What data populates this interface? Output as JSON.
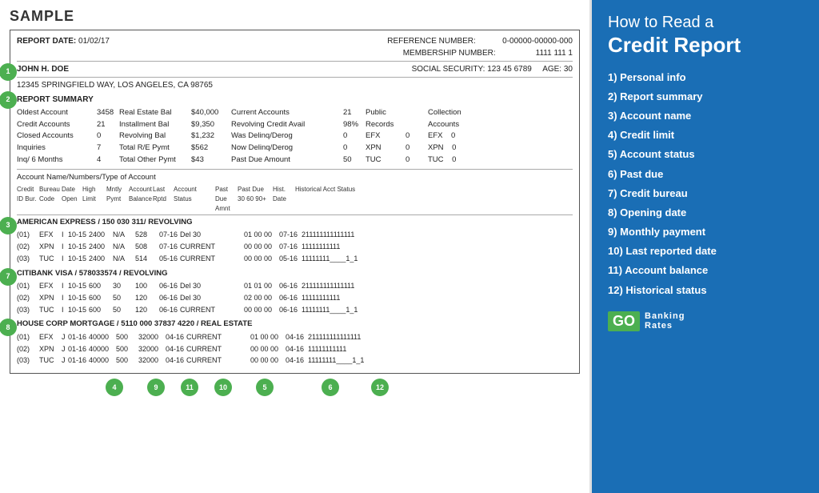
{
  "sample_label": "SAMPLE",
  "report_header": {
    "report_date_label": "REPORT DATE:",
    "report_date": "01/02/17",
    "reference_label": "REFERENCE NUMBER:",
    "reference_value": "0-00000-00000-000",
    "membership_label": "MEMBERSHIP NUMBER:",
    "membership_value": "1111 111 1"
  },
  "personal_info": {
    "name": "JOHN H. DOE",
    "social_label": "SOCIAL SECURITY:",
    "social_value": "123 45 6789",
    "age_label": "AGE:",
    "age_value": "30",
    "address": "12345 SPRINGFIELD WAY, LOS ANGELES, CA 98765"
  },
  "report_summary_label": "REPORT SUMMARY",
  "summary_rows": [
    [
      "Oldest Account",
      "3458",
      "Real Estate Bal",
      "$40,000",
      "Current Accounts",
      "21",
      "Public",
      "",
      "Collection"
    ],
    [
      "Credit Accounts",
      "21",
      "Installment Bal",
      "$9,350",
      "Revolving Credit Avail",
      "98%",
      "Records",
      "",
      "Accounts"
    ],
    [
      "Closed Accounts",
      "0",
      "Revolving Bal",
      "$1,232",
      "Was Delinq/Derog",
      "0",
      "EFX",
      "0",
      "EFX",
      "0"
    ],
    [
      "Inquiries",
      "7",
      "Total R/E Pymt",
      "$562",
      "Now Delinq/Derog",
      "0",
      "XPN",
      "0",
      "XPN",
      "0"
    ],
    [
      "Inq/ 6 Months",
      "4",
      "Total Other Pymt",
      "$43",
      "Past Due Amount",
      "50",
      "TUC",
      "0",
      "TUC",
      "0"
    ]
  ],
  "acct_header": "Account Name/Numbers/Type of Account",
  "col_headers": [
    "Credit ID Bur.",
    "Bureau Code",
    "Date Open",
    "High Limit",
    "Mntly Pymt",
    "Account Balance",
    "Last Rptd",
    "Account Status",
    "Past Due Amnt",
    "Past Due 30 60 90+",
    "Hist. Date",
    "Historical Acct Status"
  ],
  "accounts": [
    {
      "name": "AMERICAN EXPRESS / 150 030 311/ REVOLVING",
      "rows": [
        [
          "(01)",
          "EFX",
          "I",
          "10-15",
          "2400",
          "N/A",
          "528",
          "07-16",
          "Del 30",
          "",
          "01 00 00",
          "07-16",
          "211111111111111"
        ],
        [
          "(02)",
          "XPN",
          "I",
          "10-15",
          "2400",
          "N/A",
          "508",
          "07-16",
          "CURRENT",
          "",
          "00 00 00",
          "07-16",
          "11111111111"
        ],
        [
          "(03)",
          "TUC",
          "I",
          "10-15",
          "2400",
          "N/A",
          "514",
          "05-16",
          "CURRENT",
          "",
          "00 00 00",
          "05-16",
          "11111111____1_1"
        ]
      ]
    },
    {
      "name": "CITIBANK VISA / 578033574 / REVOLVING",
      "rows": [
        [
          "(01)",
          "EFX",
          "I",
          "10-15",
          "600",
          "30",
          "100",
          "06-16",
          "Del 30",
          "",
          "01 01 00",
          "06-16",
          "211111111111111"
        ],
        [
          "(02)",
          "XPN",
          "I",
          "10-15",
          "600",
          "50",
          "120",
          "06-16",
          "Del 30",
          "",
          "02 00 00",
          "06-16",
          "11111111111"
        ],
        [
          "(03)",
          "TUC",
          "I",
          "10-15",
          "600",
          "50",
          "120",
          "06-16",
          "CURRENT",
          "",
          "00 00 00",
          "06-16",
          "11111111____1_1"
        ]
      ]
    },
    {
      "name": "HOUSE CORP MORTGAGE / 5110 000 37837 4220 / REAL ESTATE",
      "rows": [
        [
          "(01)",
          "EFX",
          "J",
          "01-16",
          "40000",
          "500",
          "32000",
          "04-16",
          "CURRENT",
          "",
          "01 00 00",
          "04-16",
          "211111111111111"
        ],
        [
          "(02)",
          "XPN",
          "J",
          "01-16",
          "40000",
          "500",
          "32000",
          "04-16",
          "CURRENT",
          "",
          "00 00 00",
          "04-16",
          "11111111111"
        ],
        [
          "(03)",
          "TUC",
          "J",
          "01-16",
          "40000",
          "500",
          "32000",
          "04-16",
          "CURRENT",
          "",
          "00 00 00",
          "04-16",
          "11111111____1_1"
        ]
      ]
    }
  ],
  "bottom_badges": [
    "4",
    "9",
    "11",
    "10",
    "5",
    "6",
    "12"
  ],
  "left_badges": [
    "1",
    "2",
    "3",
    "7",
    "8"
  ],
  "right_panel": {
    "title_top": "How to Read a",
    "title_bold": "Credit Report",
    "items": [
      "1) Personal info",
      "2) Report summary",
      "3) Account name",
      "4) Credit limit",
      "5) Account status",
      "6) Past due",
      "7) Credit bureau",
      "8) Opening date",
      "9) Monthly payment",
      "10) Last reported date",
      "11) Account balance",
      "12) Historical status"
    ],
    "logo_go": "GO",
    "logo_banking": "Banking",
    "logo_rates": "Rates"
  }
}
